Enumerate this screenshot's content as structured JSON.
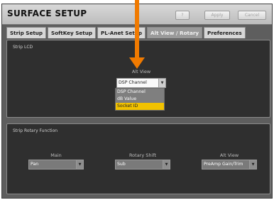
{
  "window": {
    "title": "SURFACE SETUP",
    "help_label": "?",
    "apply_label": "Apply",
    "cancel_label": "Cancel"
  },
  "tabs": [
    {
      "label": "Strip Setup",
      "active": false
    },
    {
      "label": "SoftKey Setup",
      "active": false
    },
    {
      "label": "PL-Anet Setup",
      "active": false
    },
    {
      "label": "Alt View / Rotary",
      "active": true
    },
    {
      "label": "Preferences",
      "active": false
    }
  ],
  "strip_lcd": {
    "label": "Strip LCD",
    "alt_view_caption": "Alt View",
    "alt_view_value": "DSP Channel",
    "options": [
      "DSP Channel",
      "dB Value",
      "Socket ID"
    ],
    "highlighted_option": "Socket ID"
  },
  "strip_rotary": {
    "label": "Strip Rotary Function",
    "main_caption": "Main",
    "main_value": "Pan",
    "rotary_shift_caption": "Rotary Shift",
    "rotary_shift_value": "Sub",
    "alt_view_caption": "Alt View",
    "alt_view_value": "PreAmp Gain/Trim"
  },
  "colors": {
    "annotation_arrow": "#f07a00",
    "highlight": "#f2c200"
  }
}
